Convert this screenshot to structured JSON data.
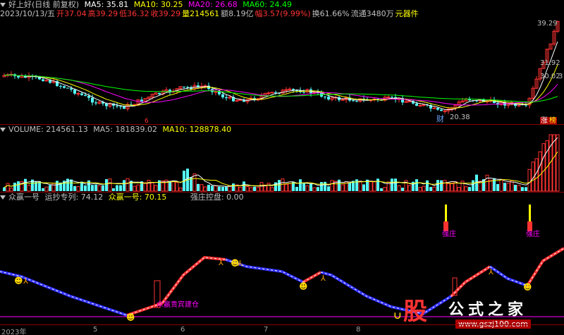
{
  "main_header": {
    "stock_name": "好上好(日线 前复权)",
    "ma5": "MA5: 35.81",
    "ma10": "MA10: 30.25",
    "ma20": "MA20: 26.68",
    "ma60": "MA60: 24.49"
  },
  "quote_line": {
    "date": "2023/10/13/五",
    "open": "开37.04",
    "high": "高39.29",
    "low": "低36.32",
    "close": "收39.29",
    "volume": "量214561",
    "amount": "额8.19亿",
    "change": "幅3.57(9.99%)",
    "turnover": "换61.66%",
    "float": "流通3480万",
    "sector": "元器件"
  },
  "price_annotations": {
    "high_price": "39.29",
    "low_price": "20.38",
    "right_price_1": "31.92",
    "right_price_2": "30.02",
    "right_price_3": "3"
  },
  "markers": {
    "red_mark": "6",
    "cai": "财",
    "zhang": "涨",
    "ting": "榜"
  },
  "volume_header": {
    "volume": "VOLUME: 214561.13",
    "ma5": "MA5: 181839.02",
    "ma10": "MA10: 128878.40"
  },
  "indicator_header": {
    "name": "众赢一号",
    "yunchao": "运抄专列: 74.12",
    "zhongying": "众赢一号: 70.15",
    "qiangzhuang": "强庄控盘: 0.00"
  },
  "indicator_labels": {
    "qiangzhuang_1": "强庄",
    "qiangzhuang_2": "强庄",
    "jianguo": "众赢贵宾建仓"
  },
  "time_axis": [
    "2023年",
    "5",
    "6",
    "7",
    "8"
  ],
  "watermark": {
    "logo_char": "股",
    "site_name": "公式之家",
    "url": "www.gszj100.com"
  },
  "colors": {
    "up": "#ff3232",
    "down": "#54ffff",
    "ma5": "#ffffff",
    "ma10": "#ffff00",
    "ma20": "#ff00ff",
    "ma60": "#00ff00",
    "grid_separator": "#8b0000"
  },
  "chart_data": {
    "type": "candlestick",
    "price_range": [
      20.38,
      39.29
    ],
    "last_close": 39.29
  }
}
